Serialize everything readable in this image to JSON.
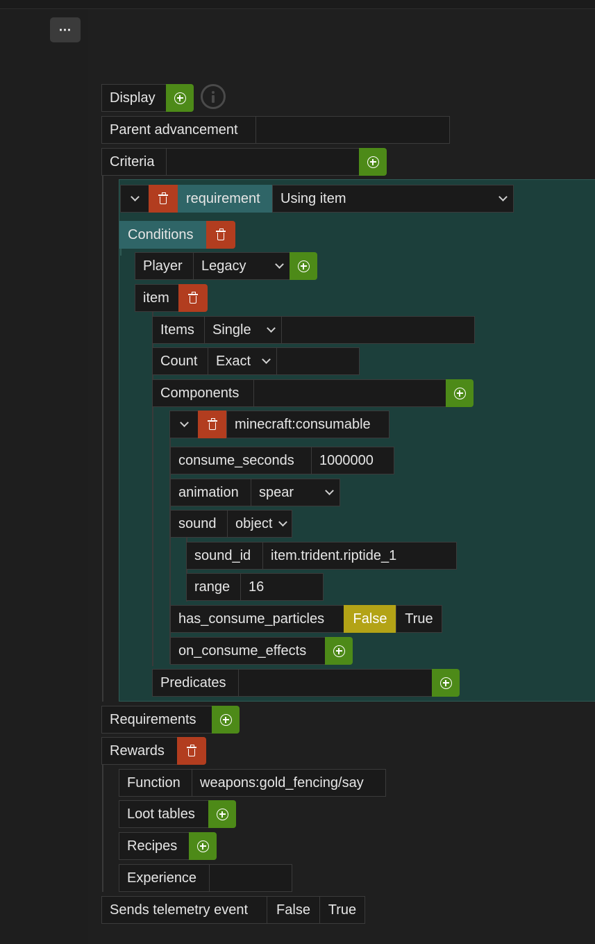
{
  "menu": {
    "label": "⋯"
  },
  "display": {
    "label": "Display"
  },
  "parent": {
    "label": "Parent advancement",
    "value": ""
  },
  "criteria": {
    "label": "Criteria",
    "value": "",
    "entry": {
      "requirement_label": "requirement",
      "requirement_value": "Using item",
      "conditions_label": "Conditions",
      "player_label": "Player",
      "player_value": "Legacy",
      "item_label": "item",
      "items_label": "Items",
      "items_value": "Single",
      "count_label": "Count",
      "count_value": "Exact",
      "components_label": "Components",
      "component_name": "minecraft:consumable",
      "consume_seconds_label": "consume_seconds",
      "consume_seconds_value": "1000000",
      "animation_label": "animation",
      "animation_value": "spear",
      "sound_label": "sound",
      "sound_value": "object",
      "sound_id_label": "sound_id",
      "sound_id_value": "item.trident.riptide_1",
      "range_label": "range",
      "range_value": "16",
      "particles_label": "has_consume_particles",
      "particles_false": "False",
      "particles_true": "True",
      "effects_label": "on_consume_effects",
      "predicates_label": "Predicates"
    }
  },
  "requirements": {
    "label": "Requirements"
  },
  "rewards": {
    "label": "Rewards",
    "function_label": "Function",
    "function_value": "weapons:gold_fencing/say",
    "loot_label": "Loot tables",
    "recipes_label": "Recipes",
    "experience_label": "Experience",
    "experience_value": ""
  },
  "telemetry": {
    "label": "Sends telemetry event",
    "false_label": "False",
    "true_label": "True"
  },
  "colors": {
    "add": "#4d8a18",
    "delete": "#b23d1f",
    "teal": "#2f6567",
    "selected": "#b3a316",
    "panel": "#1c3f3b"
  },
  "icons": [
    "more-icon",
    "plus-circle-icon",
    "trash-icon",
    "info-icon",
    "chevron-down-icon"
  ]
}
